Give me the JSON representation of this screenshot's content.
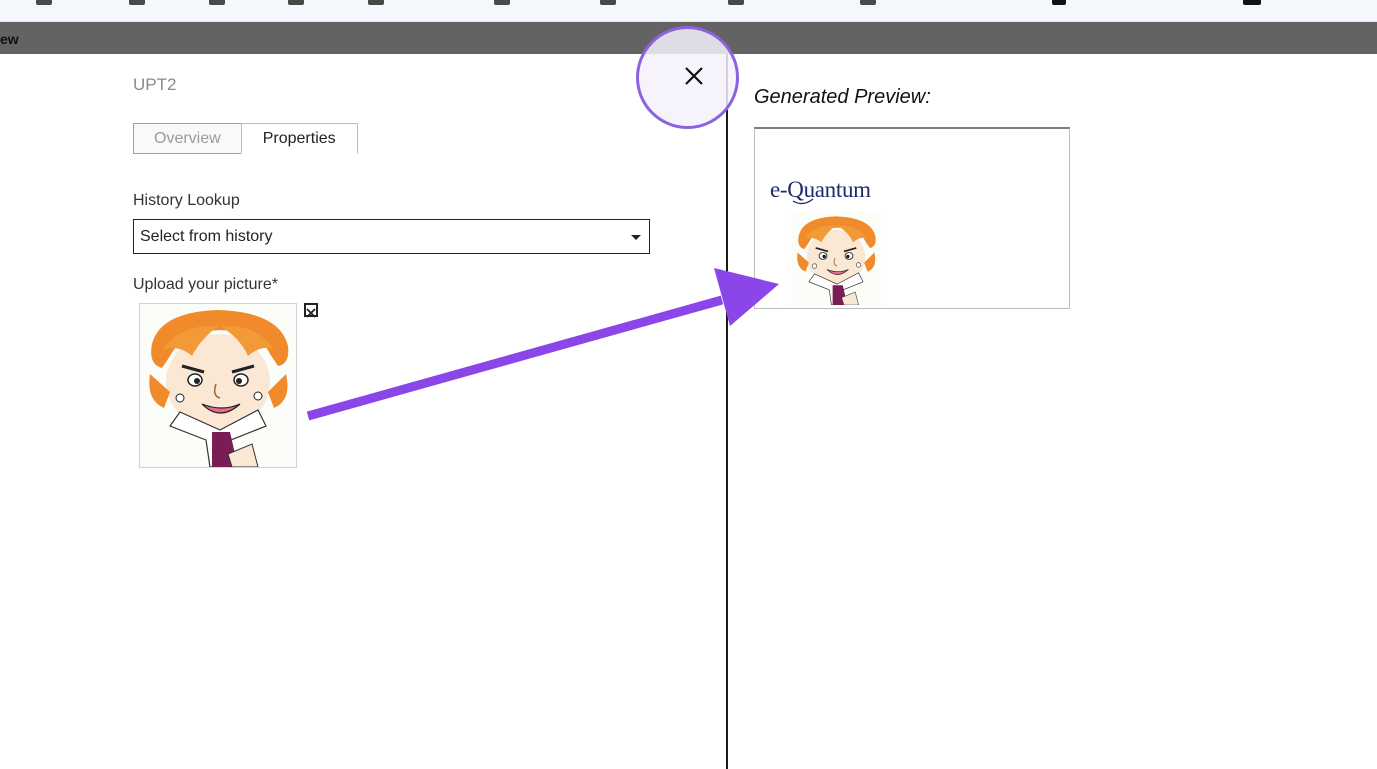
{
  "header": {
    "title": "ew"
  },
  "form": {
    "title": "UPT2",
    "tabs": [
      {
        "label": "Overview",
        "active": false
      },
      {
        "label": "Properties",
        "active": true
      }
    ],
    "history": {
      "label": "History Lookup",
      "selected": "Select from history"
    },
    "upload": {
      "label": "Upload your picture*",
      "image_icon": "cartoon-portrait-image",
      "remove_icon": "close-box-icon"
    }
  },
  "close_button": {
    "icon": "close-icon",
    "highlight_color": "#8d62e0"
  },
  "preview": {
    "label": "Generated Preview:",
    "logo_text": "e-Quantum",
    "image_icon": "cartoon-portrait-image"
  },
  "annotation": {
    "type": "arrow",
    "color": "#8a46e8"
  },
  "colors": {
    "header_bg": "#636363",
    "accent": "#8d62e0",
    "logo": "#1e2b6a"
  }
}
